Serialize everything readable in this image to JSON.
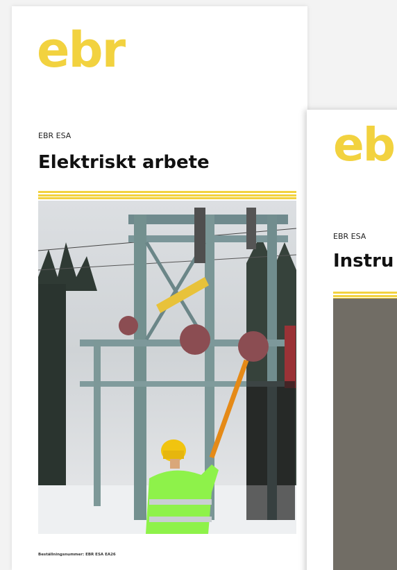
{
  "front_cover": {
    "logo_text": "ebr",
    "series": "EBR ESA",
    "title": "Elektriskt arbete",
    "order_line": "Beställningsnummer: EBR ESA EA26",
    "photo_icon": "substation-worker-photo"
  },
  "back_cover": {
    "logo_text": "ebr",
    "series": "EBR ESA",
    "title": "Instru",
    "photo_icon": "yellow-sign-photo"
  },
  "colors": {
    "brand_yellow": "#f2d23f",
    "text": "#111111",
    "page_bg": "#f3f3f3"
  }
}
